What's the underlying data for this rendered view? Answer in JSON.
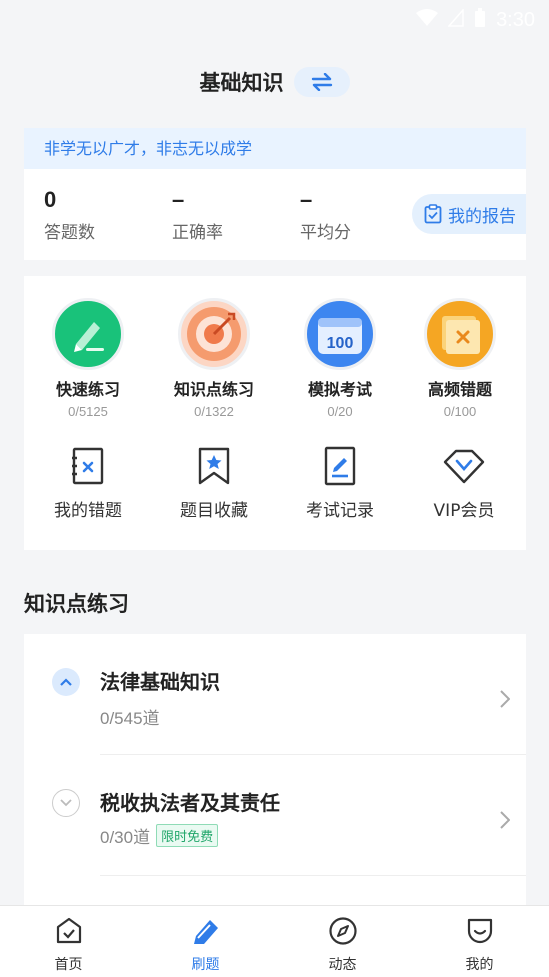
{
  "status_bar": {
    "time": "3:30",
    "icons": [
      "wifi-icon",
      "signal-icon",
      "battery-icon"
    ]
  },
  "header": {
    "title": "基础知识",
    "switch_icon": "swap-icon"
  },
  "stats": {
    "motto": "非学无以广才，非志无以成学",
    "items": [
      {
        "value": "0",
        "label": "答题数"
      },
      {
        "value": "–",
        "label": "正确率"
      },
      {
        "value": "–",
        "label": "平均分"
      }
    ],
    "report_button": {
      "label": "我的报告",
      "icon": "report-icon"
    }
  },
  "practice_modes": [
    {
      "title": "快速练习",
      "sub": "0/5125",
      "icon": "pencil-icon",
      "color": "#19c27a"
    },
    {
      "title": "知识点练习",
      "sub": "0/1322",
      "icon": "target-icon",
      "color": "#f07a4b"
    },
    {
      "title": "模拟考试",
      "sub": "0/20",
      "icon": "calendar-100-icon",
      "color": "#3d86f0",
      "icon_text": "100"
    },
    {
      "title": "高频错题",
      "sub": "0/100",
      "icon": "error-box-icon",
      "color": "#f5a623"
    }
  ],
  "secondary_tools": [
    {
      "label": "我的错题",
      "icon": "wrong-questions-icon"
    },
    {
      "label": "题目收藏",
      "icon": "bookmark-star-icon"
    },
    {
      "label": "考试记录",
      "icon": "exam-record-icon"
    },
    {
      "label": "VIP会员",
      "icon": "vip-diamond-icon"
    }
  ],
  "knowledge_section": {
    "title": "知识点练习",
    "items": [
      {
        "title": "法律基础知识",
        "sub": "0/545道",
        "expanded": true,
        "badge": ""
      },
      {
        "title": "税收执法者及其责任",
        "sub": "0/30道",
        "expanded": false,
        "badge": "限时免费"
      }
    ]
  },
  "tabbar": {
    "active": 1,
    "tabs": [
      {
        "label": "首页",
        "icon": "home-icon"
      },
      {
        "label": "刷题",
        "icon": "practice-icon"
      },
      {
        "label": "动态",
        "icon": "compass-icon"
      },
      {
        "label": "我的",
        "icon": "profile-icon"
      }
    ]
  },
  "colors": {
    "accent": "#2f7ce8",
    "free_green": "#21a66a"
  }
}
